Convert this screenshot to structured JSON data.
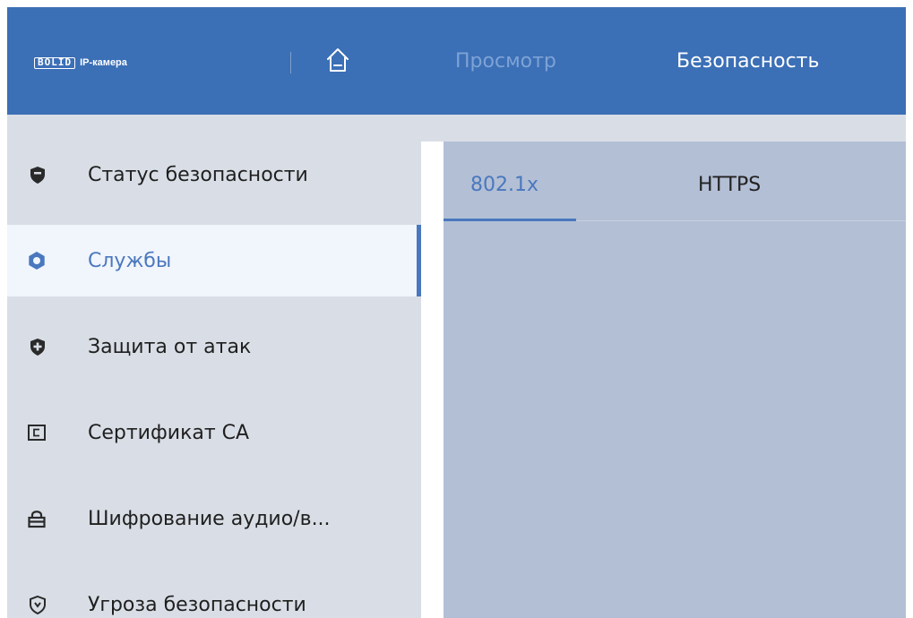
{
  "header": {
    "logo_text": "BOLID",
    "product_name": "IP-камера",
    "nav": {
      "preview": "Просмотр",
      "security": "Безопасность"
    }
  },
  "sidebar": {
    "items": [
      {
        "label": "Статус безопасности",
        "icon": "shield-icon",
        "active": false
      },
      {
        "label": "Службы",
        "icon": "gear-icon",
        "active": true
      },
      {
        "label": "Защита от атак",
        "icon": "shield-plus-icon",
        "active": false
      },
      {
        "label": "Сертификат CA",
        "icon": "certificate-icon",
        "active": false
      },
      {
        "label": "Шифрование аудио/в...",
        "icon": "lock-icon",
        "active": false
      },
      {
        "label": "Угроза безопасности",
        "icon": "shield-alert-icon",
        "active": false
      }
    ]
  },
  "main": {
    "tabs": [
      {
        "label": "802.1x",
        "active": true
      },
      {
        "label": "HTTPS",
        "active": false
      }
    ]
  },
  "colors": {
    "header_bg": "#3b6fb6",
    "accent": "#4a78be",
    "sidebar_bg": "#d9dee6",
    "sidebar_active_bg": "#f1f5fc",
    "content_bg": "#b3bfd5",
    "nav_inactive": "#7ea3d6"
  }
}
